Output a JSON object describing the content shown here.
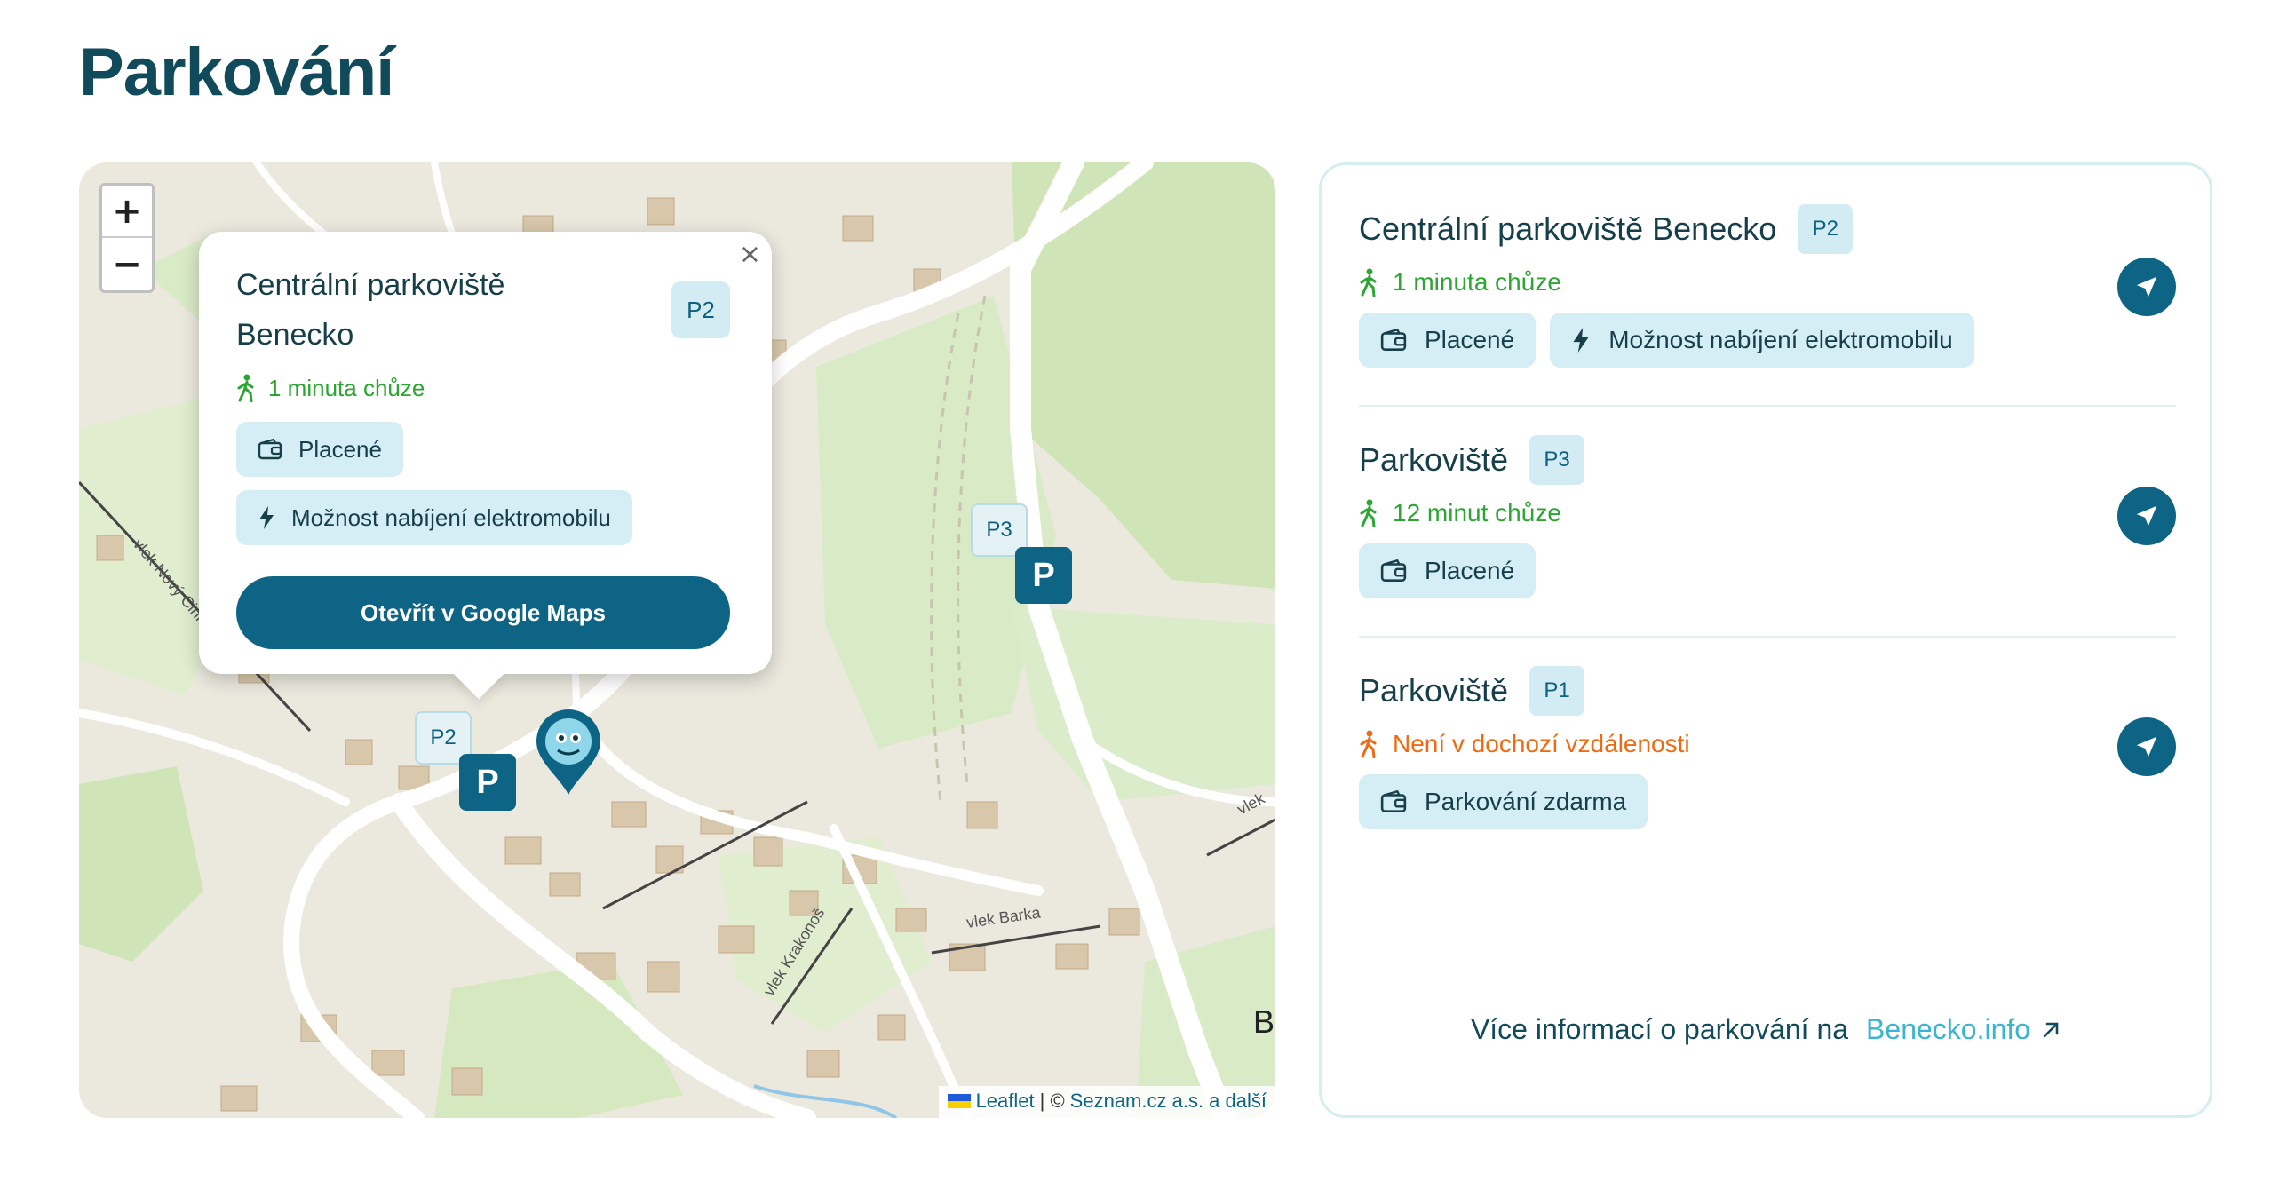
{
  "page": {
    "title": "Parkování"
  },
  "map": {
    "zoom_in": "+",
    "zoom_out": "−",
    "popup": {
      "title": "Centrální parkoviště Benecko",
      "badge": "P2",
      "walk": "1 minuta chůze",
      "tags": [
        "Placené",
        "Možnost nabíjení elektromobilu"
      ],
      "button": "Otevřít v Google Maps",
      "close": "×"
    },
    "markers": [
      {
        "label": "P3",
        "symbol": "P"
      },
      {
        "label": "P2",
        "symbol": "P"
      }
    ],
    "place_labels": [
      "vlek Nový Cinkáč",
      "vlek Krakonoš",
      "vlek Barka",
      "vlek",
      "B"
    ],
    "attribution": {
      "leaflet": "Leaflet",
      "separator": "| ©",
      "provider": "Seznam.cz a.s. a další"
    }
  },
  "parkings": [
    {
      "name": "Centrální parkoviště Benecko",
      "badge": "P2",
      "walk": "1 minuta chůze",
      "walk_status": "green",
      "tags": [
        "Placené",
        "Možnost nabíjení elektromobilu"
      ],
      "tag_icons": [
        "wallet-icon",
        "lightning-icon"
      ]
    },
    {
      "name": "Parkoviště",
      "badge": "P3",
      "walk": "12 minut chůze",
      "walk_status": "green",
      "tags": [
        "Placené"
      ],
      "tag_icons": [
        "wallet-icon"
      ]
    },
    {
      "name": "Parkoviště",
      "badge": "P1",
      "walk": "Není v dochozí vzdálenosti",
      "walk_status": "orange",
      "tags": [
        "Parkování zdarma"
      ],
      "tag_icons": [
        "wallet-icon"
      ]
    }
  ],
  "footer": {
    "text": "Více informací o parkování na",
    "link": "Benecko.info"
  },
  "colors": {
    "primary": "#0d6484",
    "green": "#2ca532",
    "orange": "#ee6b14",
    "tag_bg": "#d5edf4",
    "link": "#3ab4d3"
  }
}
